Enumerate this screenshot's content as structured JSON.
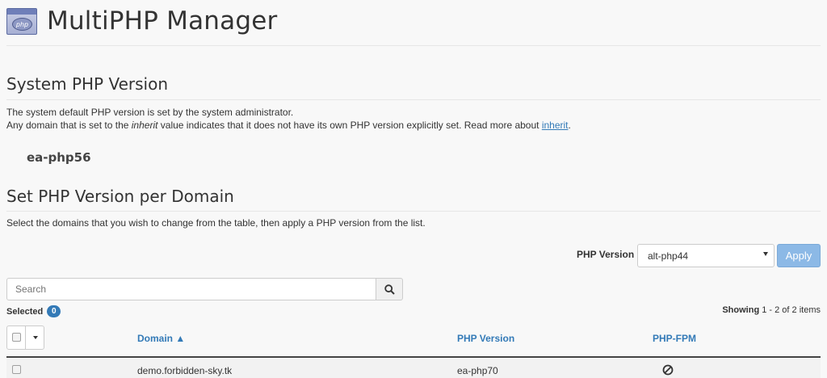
{
  "header": {
    "title": "MultiPHP Manager",
    "icon": "php-icon",
    "icon_text": "php"
  },
  "system_section": {
    "title": "System PHP Version",
    "line1": "The system default PHP version is set by the system administrator.",
    "line2_prefix": "Any domain that is set to the ",
    "line2_em": "inherit",
    "line2_middle": " value indicates that it does not have its own PHP version explicitly set. Read more about ",
    "line2_link": "inherit",
    "line2_suffix": ".",
    "current_version": "ea-php56"
  },
  "domain_section": {
    "title": "Set PHP Version per Domain",
    "description": "Select the domains that you wish to change from the table, then apply a PHP version from the list."
  },
  "controls": {
    "version_label": "PHP Version",
    "selected_version": "alt-php44",
    "apply_label": "Apply",
    "search_placeholder": "Search",
    "selected_label": "Selected",
    "selected_count": "0",
    "showing_label": "Showing",
    "showing_range": "1 - 2 of 2 items"
  },
  "table": {
    "columns": {
      "domain": "Domain ▲",
      "php_version": "PHP Version",
      "php_fpm": "PHP-FPM"
    },
    "rows": [
      {
        "domain": "demo.forbidden-sky.tk",
        "php_version": "ea-php70",
        "php_fpm_icon": "disabled-icon"
      }
    ]
  },
  "colors": {
    "link": "#337ab7",
    "apply_button": "#8cb9e6",
    "badge": "#337ab7"
  }
}
